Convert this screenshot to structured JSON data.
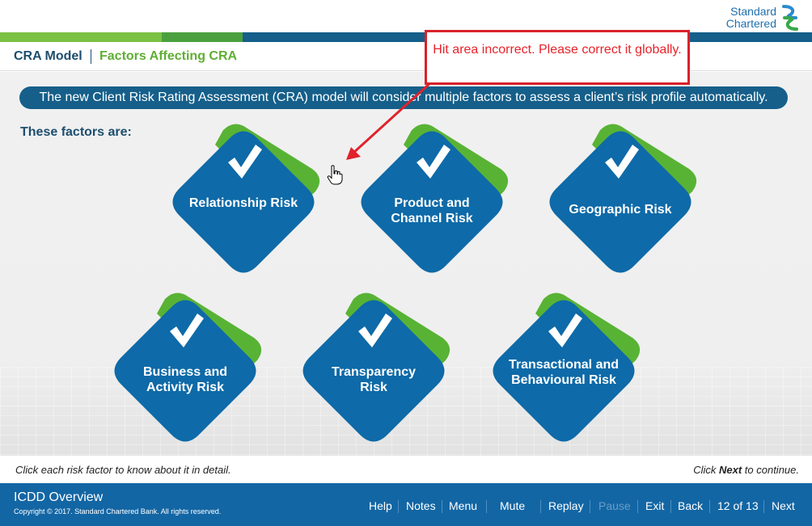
{
  "brand": {
    "line1": "Standard",
    "line2": "Chartered",
    "logo_icon": "sc-logo-icon"
  },
  "stripe_colors": [
    "#7bc143",
    "#4aa03f",
    "#155f8a",
    "#155f8a",
    "#1aa0dc",
    "#0a6aa7",
    "#155f8a"
  ],
  "breadcrumb": {
    "model": "CRA Model",
    "page": "Factors Affecting CRA"
  },
  "banner": "The new Client Risk Rating Assessment (CRA) model will consider multiple factors to assess a client’s risk profile automatically.",
  "factors_label": "These factors are:",
  "tiles": [
    {
      "label": "Relationship Risk",
      "icon": "checkmark-icon"
    },
    {
      "label": "Product and Channel Risk",
      "icon": "checkmark-icon"
    },
    {
      "label": "Geographic Risk",
      "icon": "checkmark-icon"
    },
    {
      "label": "Business and Activity Risk",
      "icon": "checkmark-icon"
    },
    {
      "label": "Transparency Risk",
      "icon": "checkmark-icon"
    },
    {
      "label": "Transactional and Behavioural Risk",
      "icon": "checkmark-icon"
    }
  ],
  "annotation": "Hit area incorrect. Please correct it globally.",
  "instructions": {
    "left": "Click each risk factor to know about it in detail.",
    "right_pre": "Click ",
    "right_bold": "Next",
    "right_post": " to continue."
  },
  "footer": {
    "course": "ICDD Overview",
    "copyright": "Copyright © 2017. Standard Chartered Bank. All rights reserved.",
    "nav": {
      "help": "Help",
      "notes": "Notes",
      "menu": "Menu",
      "mute": "Mute",
      "replay": "Replay",
      "pause": "Pause",
      "exit": "Exit",
      "back": "Back",
      "page": "12 of 13",
      "next": "Next"
    }
  },
  "colors": {
    "tile_blue": "#0e6aa8",
    "tile_green": "#58b335",
    "annotation_red": "#d9222a",
    "footer_blue": "#1366a4"
  }
}
